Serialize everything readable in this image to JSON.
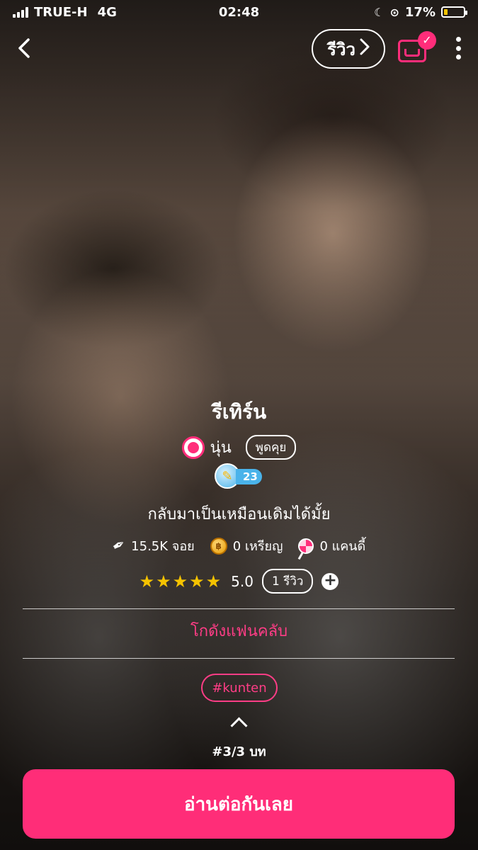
{
  "status_bar": {
    "carrier": "TRUE-H",
    "network": "4G",
    "time": "02:48",
    "battery": "17%"
  },
  "nav": {
    "review_label": "รีวิว",
    "review_chevron": ">",
    "back_glyph": "<",
    "shelf_check": "✓"
  },
  "story": {
    "title": "รีเทิร์น",
    "author": "นุ่น",
    "chat_label": "พูดคุย",
    "level": "23",
    "tagline": "กลับมาเป็นเหมือนเดิมได้มั้ย",
    "stats": {
      "views": "15.5K จอย",
      "coins": "0 เหรียญ",
      "candy": "0 แคนดี้"
    },
    "rating": {
      "stars": "★★★★★",
      "score": "5.0",
      "review_count": "1 รีวิว",
      "add": "+"
    },
    "fanclub": "โกดังแฟนคลับ",
    "tag": "#kunten",
    "chapter": "#3/3 บท"
  },
  "cta": {
    "label": "อ่านต่อกันเลย"
  },
  "colors": {
    "accent": "#ff2d78",
    "star": "#f5c300",
    "level_badge": "#4ab3ea"
  },
  "icons": [
    "back-icon",
    "chevron-right-icon",
    "shelf-icon",
    "more-icon",
    "pen-icon",
    "coin-icon",
    "candy-icon",
    "plus-icon",
    "chevron-up-icon"
  ]
}
